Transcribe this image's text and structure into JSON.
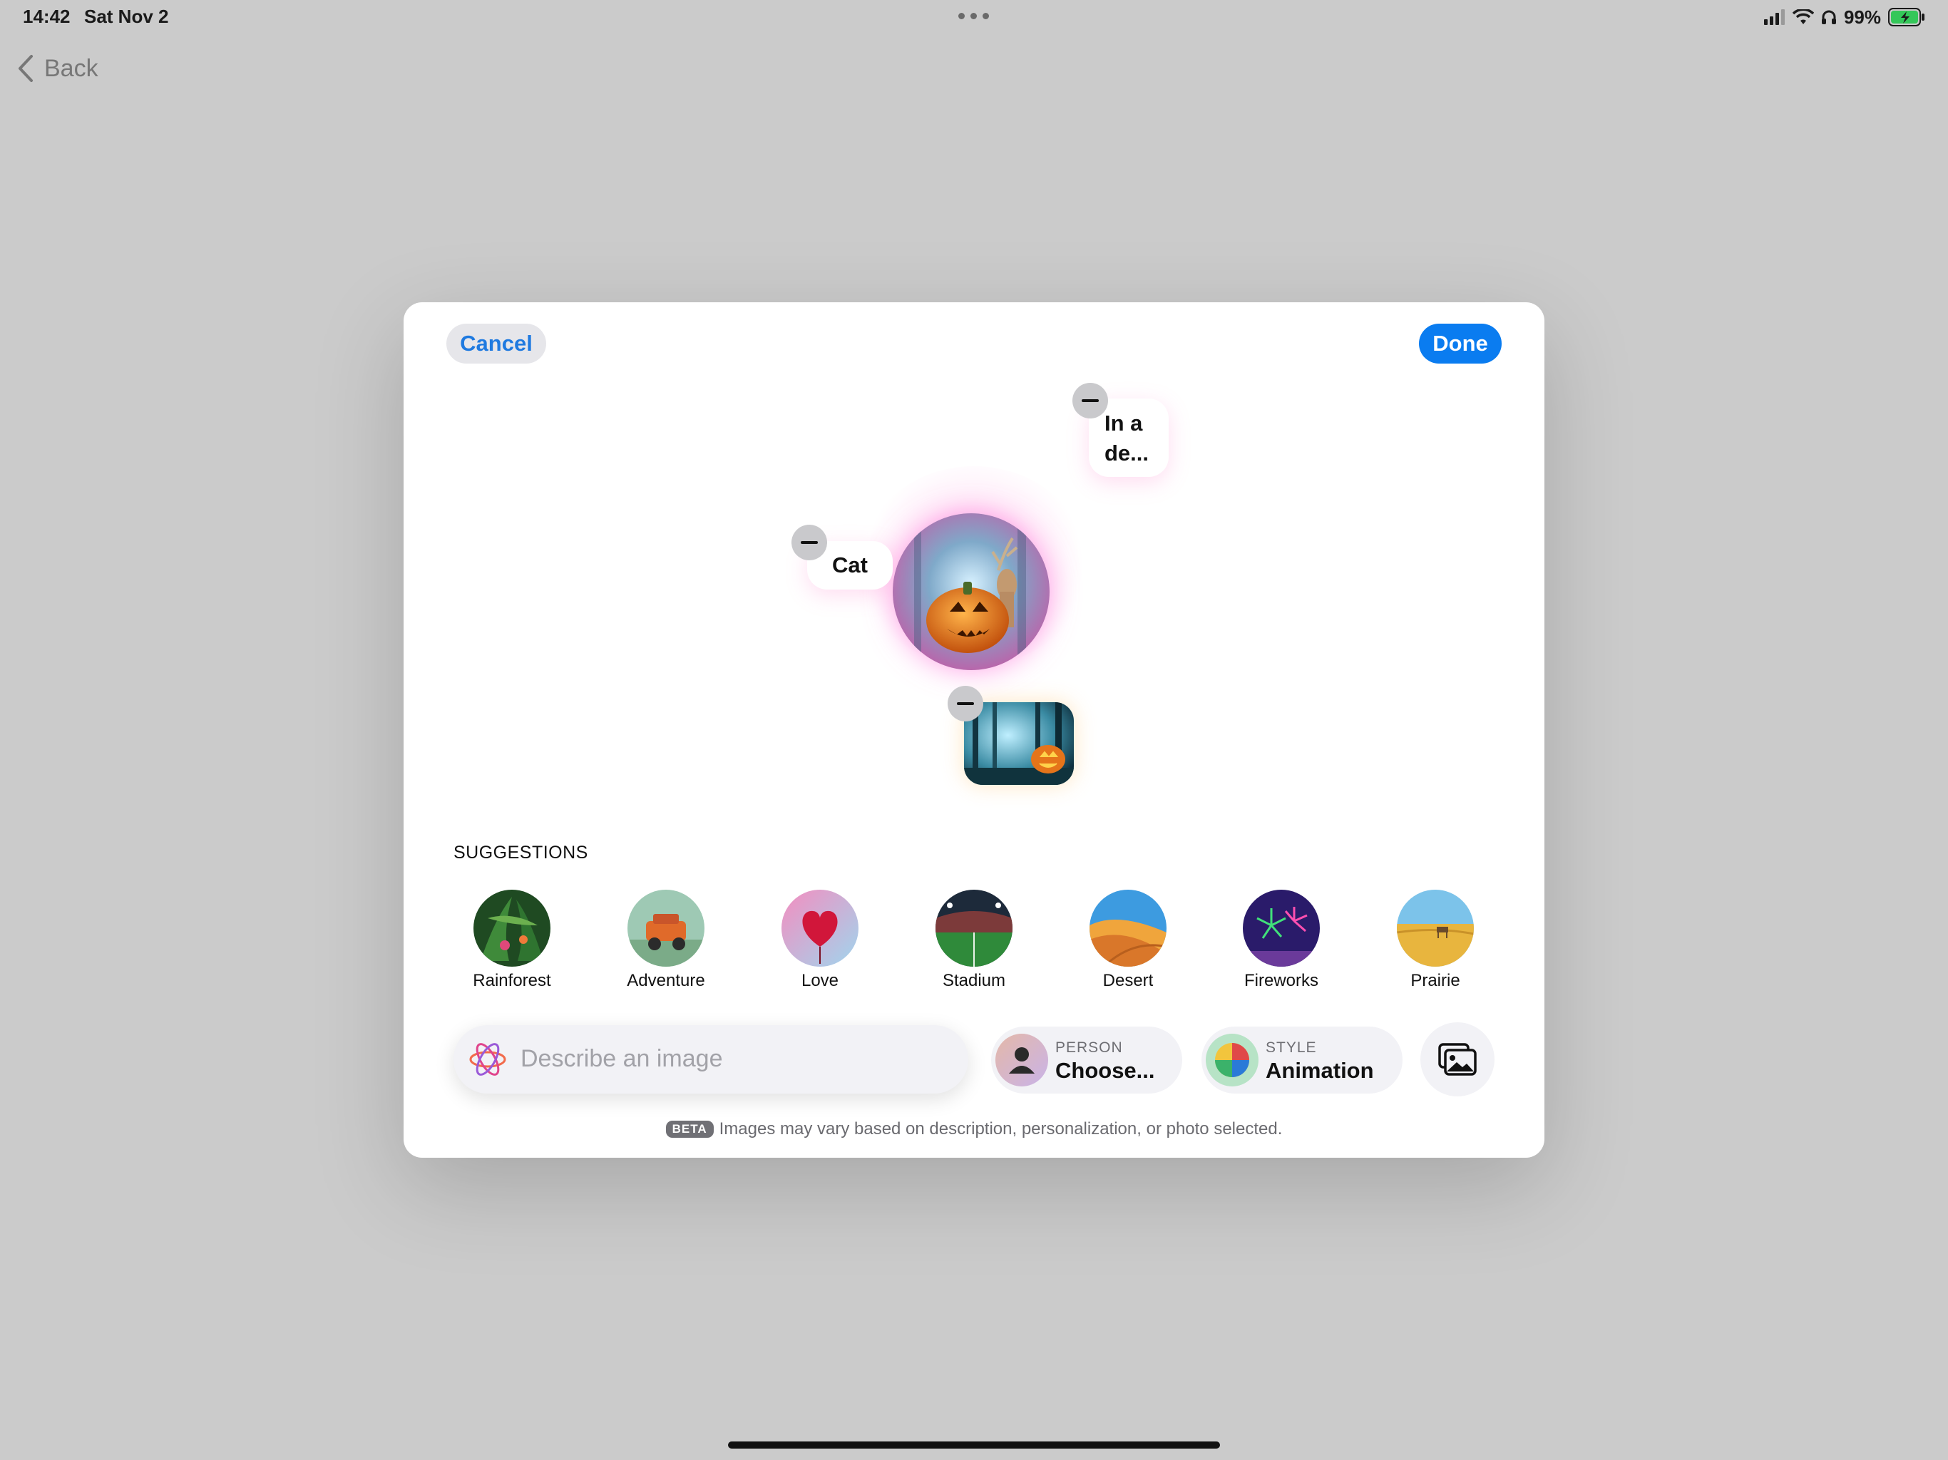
{
  "status_bar": {
    "time": "14:42",
    "date": "Sat Nov 2",
    "battery_percent": "99%"
  },
  "nav": {
    "back_label": "Back"
  },
  "modal": {
    "cancel_label": "Cancel",
    "done_label": "Done",
    "concepts": {
      "cat_label": "Cat",
      "description_line1": "In a",
      "description_line2": "de..."
    },
    "suggestions": {
      "heading": "SUGGESTIONS",
      "items": [
        {
          "label": "Rainforest"
        },
        {
          "label": "Adventure"
        },
        {
          "label": "Love"
        },
        {
          "label": "Stadium"
        },
        {
          "label": "Desert"
        },
        {
          "label": "Fireworks"
        },
        {
          "label": "Prairie"
        }
      ]
    },
    "prompt_placeholder": "Describe an image",
    "person": {
      "caption": "PERSON",
      "value": "Choose..."
    },
    "style": {
      "caption": "STYLE",
      "value": "Animation"
    },
    "beta_badge": "BETA",
    "disclaimer": "Images may vary based on description, personalization, or photo selected."
  },
  "colors": {
    "accent": "#0a7cf0",
    "background": "#cbcbcb",
    "modal": "#ffffff",
    "battery": "#34c759"
  }
}
